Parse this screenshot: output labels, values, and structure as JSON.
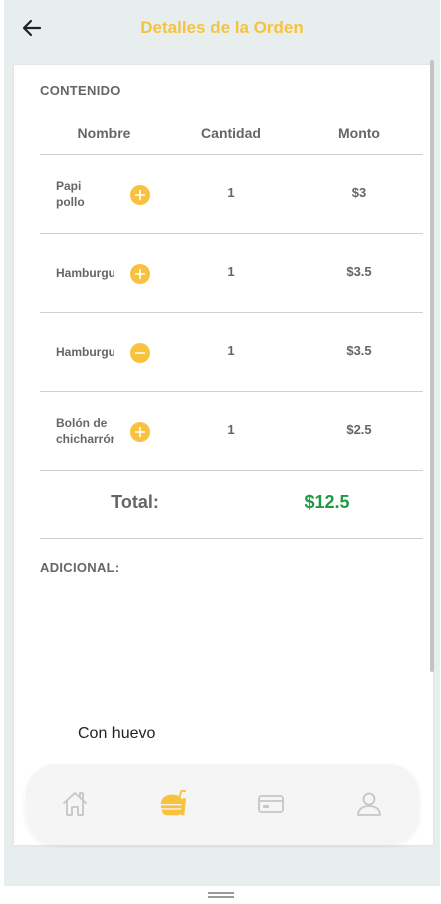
{
  "header": {
    "title": "Detalles de la Orden",
    "back_icon": "arrow-left-icon"
  },
  "content": {
    "section_title": "CONTENIDO",
    "columns": [
      "Nombre",
      "Cantidad",
      "Monto"
    ],
    "items": [
      {
        "name": "Papi pollo",
        "action": "+",
        "action_icon": "plus-circle-icon",
        "quantity": "1",
        "amount": "$3"
      },
      {
        "name": "Hamburguesa",
        "action": "+",
        "action_icon": "plus-circle-icon",
        "quantity": "1",
        "amount": "$3.5"
      },
      {
        "name": "Hamburguesa",
        "action": "−",
        "action_icon": "minus-circle-icon",
        "quantity": "1",
        "amount": "$3.5"
      },
      {
        "name": "Bolón de chicharrón",
        "action": "+",
        "action_icon": "plus-circle-icon",
        "quantity": "1",
        "amount": "$2.5"
      }
    ],
    "total_label": "Total:",
    "total_value": "$12.5"
  },
  "additional": {
    "section_title": "ADICIONAL:",
    "items": [
      "Con huevo"
    ]
  },
  "nav": {
    "items": [
      {
        "icon": "home-icon",
        "active": false
      },
      {
        "icon": "food-order-icon",
        "active": true
      },
      {
        "icon": "credit-card-icon",
        "active": false
      },
      {
        "icon": "user-profile-icon",
        "active": false
      }
    ]
  },
  "colors": {
    "accent": "#f5c43d",
    "total": "#1e9a46",
    "text": "#666666"
  }
}
